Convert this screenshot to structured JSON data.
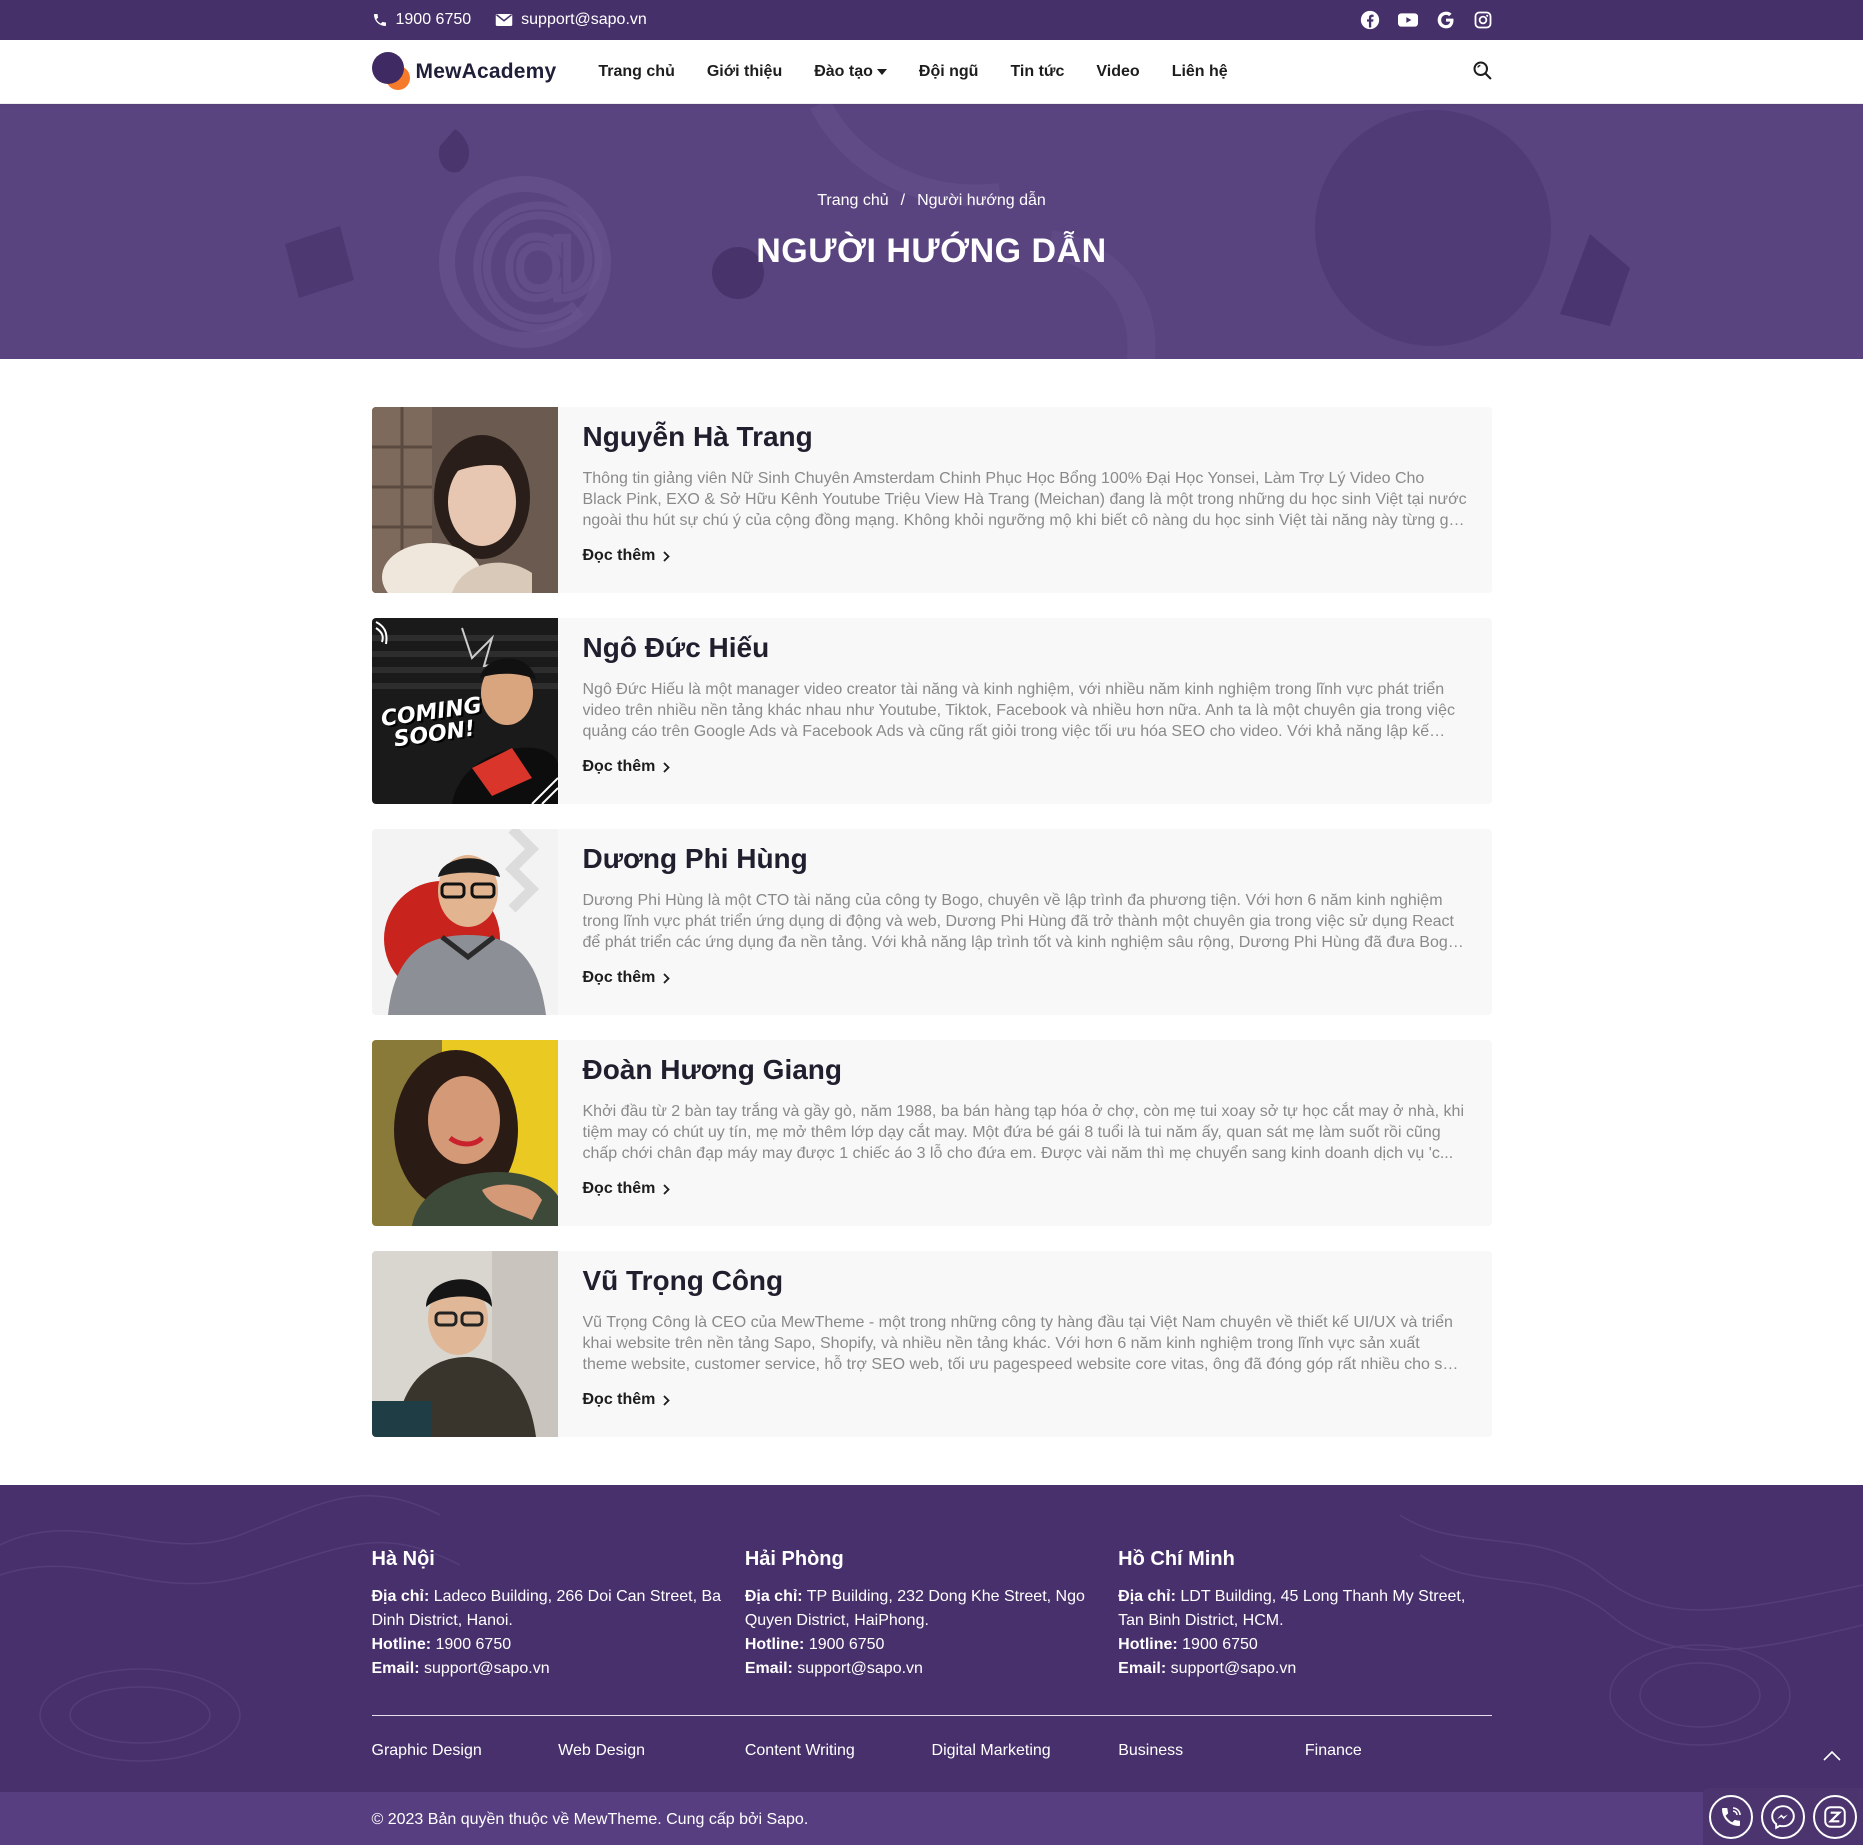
{
  "topbar": {
    "phone": "1900 6750",
    "email": "support@sapo.vn",
    "social": [
      "facebook-icon",
      "youtube-icon",
      "google-icon",
      "instagram-icon"
    ]
  },
  "header": {
    "logo_text": "MewAcademy",
    "nav": [
      {
        "label": "Trang chủ"
      },
      {
        "label": "Giới thiệu"
      },
      {
        "label": "Đào tạo",
        "has_dropdown": true
      },
      {
        "label": "Đội ngũ"
      },
      {
        "label": "Tin tức"
      },
      {
        "label": "Video"
      },
      {
        "label": "Liên hệ"
      }
    ]
  },
  "hero": {
    "breadcrumb_home": "Trang chủ",
    "breadcrumb_sep": "/",
    "breadcrumb_current": "Người hướng dẫn",
    "title": "NGƯỜI HƯỚNG DẪN"
  },
  "mentors": [
    {
      "name": "Nguyễn Hà Trang",
      "desc": "Thông tin giảng viên Nữ Sinh Chuyên Amsterdam Chinh Phục Học Bổng 100% Đại Học Yonsei, Làm Trợ Lý Video Cho Black Pink, EXO & Sở Hữu Kênh Youtube Triệu View Hà Trang (Meichan) đang là một trong những du học sinh Việt tại nước ngoài thu hút sự chú ý của cộng đồng mạng. Không khỏi ngưỡng mộ khi biết cô nàng du học sinh Việt tài năng này từng gặp g...",
      "more": "Đọc thêm"
    },
    {
      "name": "Ngô Đức Hiếu",
      "desc": "Ngô Đức Hiếu là một manager video creator tài năng và kinh nghiệm, với nhiều năm kinh nghiệm trong lĩnh vực phát triển video trên nhiều nền tảng khác nhau như Youtube, Tiktok, Facebook và nhiều hơn nữa. Anh ta là một chuyên gia trong việc quảng cáo trên Google Ads và Facebook Ads và cũng rất giỏi trong việc tối ưu hóa SEO cho video. Với khả năng lập kế hoạc...",
      "more": "Đọc thêm",
      "badge": "COMING SOON!"
    },
    {
      "name": "Dương Phi Hùng",
      "desc": "Dương Phi Hùng là một CTO tài năng của công ty Bogo, chuyên về lập trình đa phương tiện. Với hơn 6 năm kinh nghiệm trong lĩnh vực phát triển ứng dụng di động và web, Dương Phi Hùng đã trở thành một chuyên gia trong việc sử dụng React để phát triển các ứng dụng đa nền tảng. Với khả năng lập trình tốt và kinh nghiệm sâu rộng, Dương Phi Hùng đã đưa Bogo trở thà...",
      "more": "Đọc thêm"
    },
    {
      "name": "Đoàn Hương Giang",
      "desc": "Khởi đầu từ 2 bàn tay trắng và gầy gò, năm 1988, ba bán hàng tạp hóa ở chợ, còn mẹ tui xoay sở tự học cắt may ở nhà, khi tiệm may có chút uy tín, mẹ mở thêm lớp dạy cắt may. Một đứa bé gái 8 tuổi là tui năm ấy, quan sát mẹ làm suốt rồi cũng chấp chới chân đạp máy may được 1 chiếc áo 3 lỗ cho đứa em. Được vài năm thì mẹ chuyển sang kinh doanh dịch vụ 'c...",
      "more": "Đọc thêm"
    },
    {
      "name": "Vũ Trọng Công",
      "desc": "Vũ Trọng Công là CEO của MewTheme - một trong những công ty hàng đầu tại Việt Nam chuyên về thiết kế UI/UX và triển khai website trên nền tảng Sapo, Shopify, và nhiều nền tảng khác. Với hơn 6 năm kinh nghiệm trong lĩnh vực sản xuất theme website, customer service, hỗ trợ SEO web, tối ưu pagespeed website core vitas, ông đã đóng góp rất nhiều cho sự phát tri...",
      "more": "Đọc thêm"
    }
  ],
  "footer": {
    "branches": [
      {
        "city": "Hà Nội",
        "addr_label": "Địa chỉ:",
        "addr": " Ladeco Building, 266 Doi Can Street, Ba Dinh District, Hanoi.",
        "hotline_label": "Hotline:",
        "hotline": " 1900 6750",
        "email_label": "Email:",
        "email": " support@sapo.vn"
      },
      {
        "city": "Hải Phòng",
        "addr_label": "Địa chỉ:",
        "addr": " TP Building, 232 Dong Khe Street, Ngo Quyen District, HaiPhong.",
        "hotline_label": "Hotline:",
        "hotline": " 1900 6750",
        "email_label": "Email:",
        "email": " support@sapo.vn"
      },
      {
        "city": "Hồ Chí Minh",
        "addr_label": "Địa chỉ:",
        "addr": " LDT Building, 45 Long Thanh My Street, Tan Binh District, HCM.",
        "hotline_label": "Hotline:",
        "hotline": " 1900 6750",
        "email_label": "Email:",
        "email": " support@sapo.vn"
      }
    ],
    "links": [
      "Graphic Design",
      "Web Design",
      "Content Writing",
      "Digital Marketing",
      "Business",
      "Finance"
    ],
    "copyright": "© 2023 Bản quyền thuộc về MewTheme. Cung cấp bởi Sapo."
  },
  "colors": {
    "brand_dark": "#46306a",
    "hero_bg": "#5a4480",
    "accent_orange": "#f57a2a"
  }
}
